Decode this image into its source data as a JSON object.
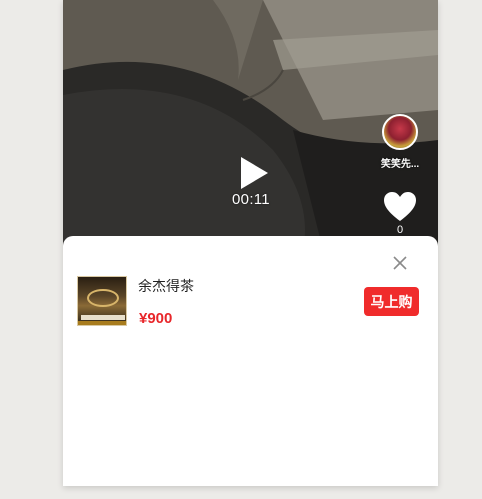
{
  "video": {
    "duration": "00:11",
    "author_name": "笑笑先...",
    "like_count": "0"
  },
  "product_sheet": {
    "product_name": "余杰得茶",
    "price": "¥900",
    "buy_label": "马上购",
    "accent_color": "#f02b2b"
  },
  "icons": {
    "play": "play-icon",
    "heart": "heart-icon",
    "close": "close-icon"
  }
}
